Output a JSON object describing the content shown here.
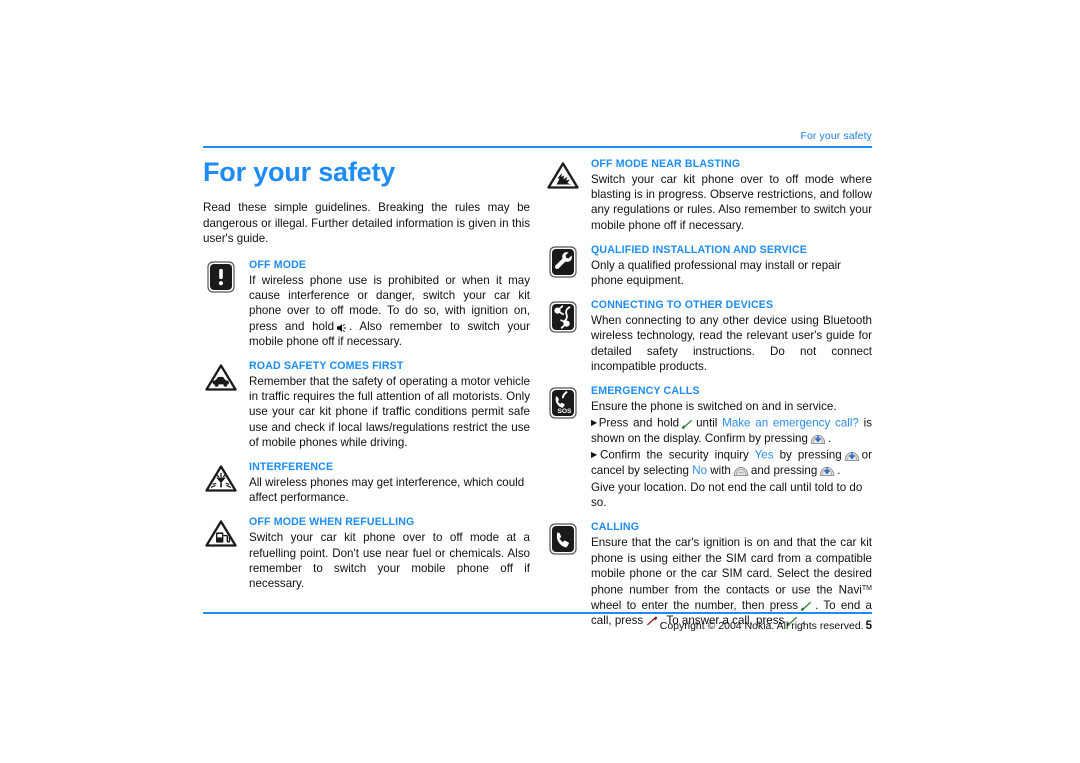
{
  "page": {
    "running_header": "For your safety",
    "chapter_title": "For your safety",
    "intro": "Read these simple guidelines. Breaking the rules may be dangerous or illegal. Further detailed information is given in this user's guide.",
    "footer_copyright": "Copyright © 2004 Nokia. All rights reserved.",
    "page_number": "5",
    "accent_color": "#1d8cf5",
    "text_color": "#111111"
  },
  "left_column": {
    "sections": [
      {
        "icon": "exclamation-square-icon",
        "title": "OFF MODE",
        "body_prefix": "If wireless phone use is prohibited or when it may cause interference or danger, switch your car kit phone over to off mode. To do so, with ignition on, press and hold",
        "body_suffix": ". Also remember to switch your mobile phone off if necessary."
      },
      {
        "icon": "car-warning-triangle-icon",
        "title": "ROAD SAFETY COMES FIRST",
        "body": "Remember that the safety of operating a motor vehicle in traffic requires the full attention of all motorists. Only use your car kit phone if traffic conditions permit safe use and check if local laws/regulations restrict the use of mobile phones while driving."
      },
      {
        "icon": "interference-warning-triangle-icon",
        "title": "INTERFERENCE",
        "body": "All wireless phones may get interference, which could affect performance."
      },
      {
        "icon": "fuel-pump-warning-triangle-icon",
        "title": "OFF MODE WHEN REFUELLING",
        "body": "Switch your car kit phone over to off mode at a refuelling point. Don't use near fuel or chemicals. Also remember to switch your mobile phone off if necessary."
      }
    ]
  },
  "right_column": {
    "sections": [
      {
        "icon": "blasting-warning-triangle-icon",
        "title": "OFF MODE NEAR BLASTING",
        "body": "Switch your car kit phone over to off mode where blasting is in progress. Observe restrictions, and follow any regulations or rules. Also remember to switch your mobile phone off if necessary."
      },
      {
        "icon": "wrench-square-icon",
        "title": "QUALIFIED INSTALLATION AND SERVICE",
        "body": "Only a qualified professional may install or repair phone equipment."
      },
      {
        "icon": "bluetooth-connect-square-icon",
        "title": "CONNECTING TO OTHER DEVICES",
        "body": "When connecting to any other device using Bluetooth wireless technology, read the relevant user's guide for detailed safety instructions. Do not connect incompatible products."
      },
      {
        "icon": "emergency-sos-phone-square-icon",
        "title": "EMERGENCY CALLS",
        "body": "Ensure the phone is switched on and in service.",
        "steps": [
          {
            "marker": "▶",
            "part1": "Press and hold",
            "glyph1": "call-key-icon",
            "part2": "until",
            "link": "Make an emergency call?",
            "part3": "is shown on the display. Confirm by pressing",
            "glyph2": "navi-wheel-press-icon",
            "part4": "."
          },
          {
            "marker": "▶",
            "part1": "Confirm the security inquiry",
            "link1": "Yes",
            "part2": "by pressing",
            "glyph1": "navi-wheel-press-icon",
            "part3": "or cancel by selecting",
            "link2": "No",
            "part4": "with",
            "glyph2": "navi-wheel-scroll-icon",
            "part5": "and pressing",
            "glyph3": "navi-wheel-press-icon",
            "part6": "."
          }
        ],
        "closing": "Give your location. Do not end the call until told to do so."
      },
      {
        "icon": "phone-square-icon",
        "title": "CALLING",
        "body_p1": "Ensure that the car's ignition is on and that the car kit phone is using either the SIM card from a compatible mobile phone or the car SIM card. Select the desired phone number from the contacts or use the Navi",
        "trademark": "TM",
        "body_p2": "wheel to enter the number, then press",
        "glyph1": "call-key-icon",
        "body_p3": ". To end a call, press",
        "glyph2": "end-key-icon",
        "body_p4": ". To answer a call, press",
        "glyph3": "call-key-icon",
        "body_p5": "."
      }
    ]
  },
  "inline_glyphs": {
    "speaker-mute-icon": "speaker key",
    "call-key-icon": "green call key",
    "end-key-icon": "red end key",
    "navi-wheel-press-icon": "navi wheel press down",
    "navi-wheel-scroll-icon": "navi wheel scroll"
  }
}
